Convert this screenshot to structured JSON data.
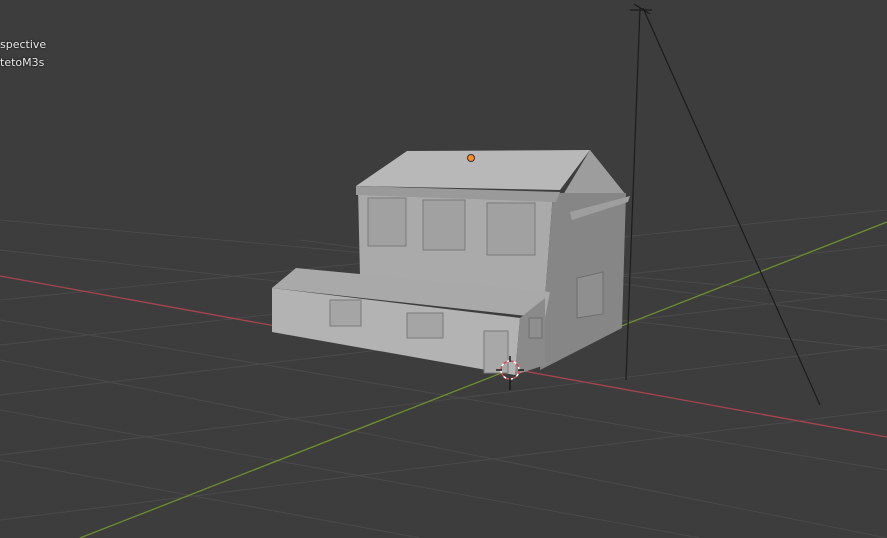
{
  "viewport": {
    "view_label": "spective",
    "object_label": "tetoM3s"
  },
  "colors": {
    "background": "#3d3d3d",
    "grid_line": "#4a4a4a",
    "x_axis": "#a8444f",
    "y_axis": "#6c8f2e",
    "mesh_light": "#b3b3b3",
    "mesh_mid": "#9d9d9d",
    "mesh_dark": "#7e7e7e",
    "origin_dot": "#ff8a1f"
  },
  "icons": {
    "origin": "object-origin-icon",
    "cursor": "3d-cursor-icon",
    "camera": "camera-wireframe-icon"
  }
}
